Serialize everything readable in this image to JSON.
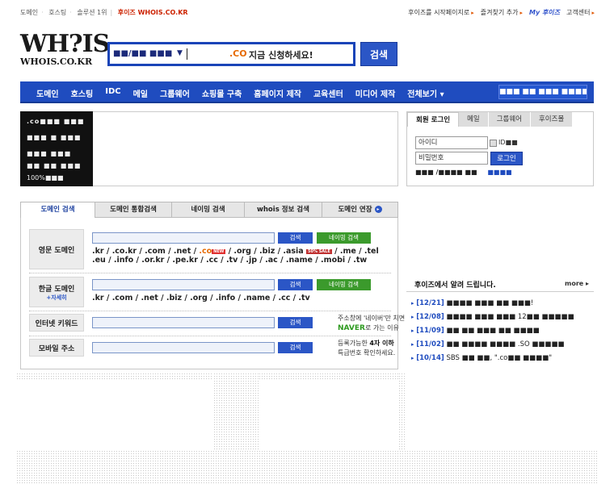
{
  "top": {
    "left_items": [
      "도메인",
      "호스팅",
      "솔루션 1위"
    ],
    "brand": "후이즈 WHOIS.CO.KR",
    "right_items": [
      "후이즈를 시작페이지로",
      "즐겨찾기 추가",
      "My 후이즈",
      "고객센터"
    ]
  },
  "logo": {
    "big": "WH?IS",
    "small": "WHOIS.CO.KR"
  },
  "search": {
    "selected": "■■/■■ ■■■",
    "chevron": "▼",
    "co_label": ".CO",
    "promo": "지금 신청하세요!",
    "button": "검색"
  },
  "nav": {
    "items": [
      "도메인",
      "호스팅",
      "IDC",
      "메일",
      "그룹웨어",
      "쇼핑몰 구축",
      "홈페이지 제작",
      "교육센터",
      "미디어 제작",
      "전체보기 ▾"
    ],
    "banner": "■■■ ■■ ■■■ ■■■■!"
  },
  "darkbox": {
    "lines": [
      ".co■■■ ■■■",
      "■■■ ■ ■■■",
      "■■■ ■■■",
      "■■ ■■ ■■■"
    ],
    "pct": "100%■■■"
  },
  "login": {
    "tabs": [
      "회원 로그인",
      "메일",
      "그룹웨어",
      "후이즈몰"
    ],
    "id_placeholder": "아이디",
    "pw_placeholder": "비밀번호",
    "save_label": "ID■■",
    "button": "로그인",
    "link1": "■■■ /■■■■ ■■",
    "link2": "■■■■"
  },
  "domain": {
    "tabs": [
      "도메인 검색",
      "도메인 통합검색",
      "네이밍 검색",
      "whois 정보 검색",
      "도메인 연장"
    ],
    "rows": {
      "eng_label": "영문 도메인",
      "kor_label": "한글 도메인",
      "kor_sub": "+자세히",
      "kw_label": "인터넷 키워드",
      "mobile_label": "모바일 주소"
    },
    "search_btn": "검색",
    "naming_btn": "네이밍 검색",
    "eng_tld_line1a": ".kr / .co.kr / .com / .net /",
    "eng_co": ".co",
    "eng_new": "NEW",
    "eng_tld_line1b": "/ .org / .biz / .asia",
    "eng_sale": "50% SALE",
    "eng_tld_line1c": "/ .me / .tel",
    "eng_tld_line2": ".eu / .info / .or.kr / .pe.kr / .cc / .tv / .jp / .ac / .name / .mobi / .tw",
    "kor_tld": ".kr / .com / .net / .biz / .org / .info / .name / .cc / .tv",
    "kw_note1": "주소창에 '네이버'만 치면",
    "kw_naver": "NAVER",
    "kw_note2": "로 가는 이유",
    "mob_note1": "등록가능한 ",
    "mob_bold": "4자 이하",
    "mob_note2": "특급번호 확인하세요."
  },
  "notice": {
    "title": "후이즈에서 알려 드립니다.",
    "more": "more ▸",
    "items": [
      {
        "date": "[12/21]",
        "text": "■■■■ ■■■ ■■ ■■■!"
      },
      {
        "date": "[12/08]",
        "text": "■■■■ ■■■ ■■■ 12■■ ■■■■■"
      },
      {
        "date": "[11/09]",
        "text": "■■ ■■ ■■■ ■■ ■■■■"
      },
      {
        "date": "[11/02]",
        "text": "■■ ■■■■ ■■■■ .SO ■■■■■"
      },
      {
        "date": "[10/14]",
        "text": "SBS ■■ ■■, \".co■■ ■■■■\""
      }
    ]
  }
}
